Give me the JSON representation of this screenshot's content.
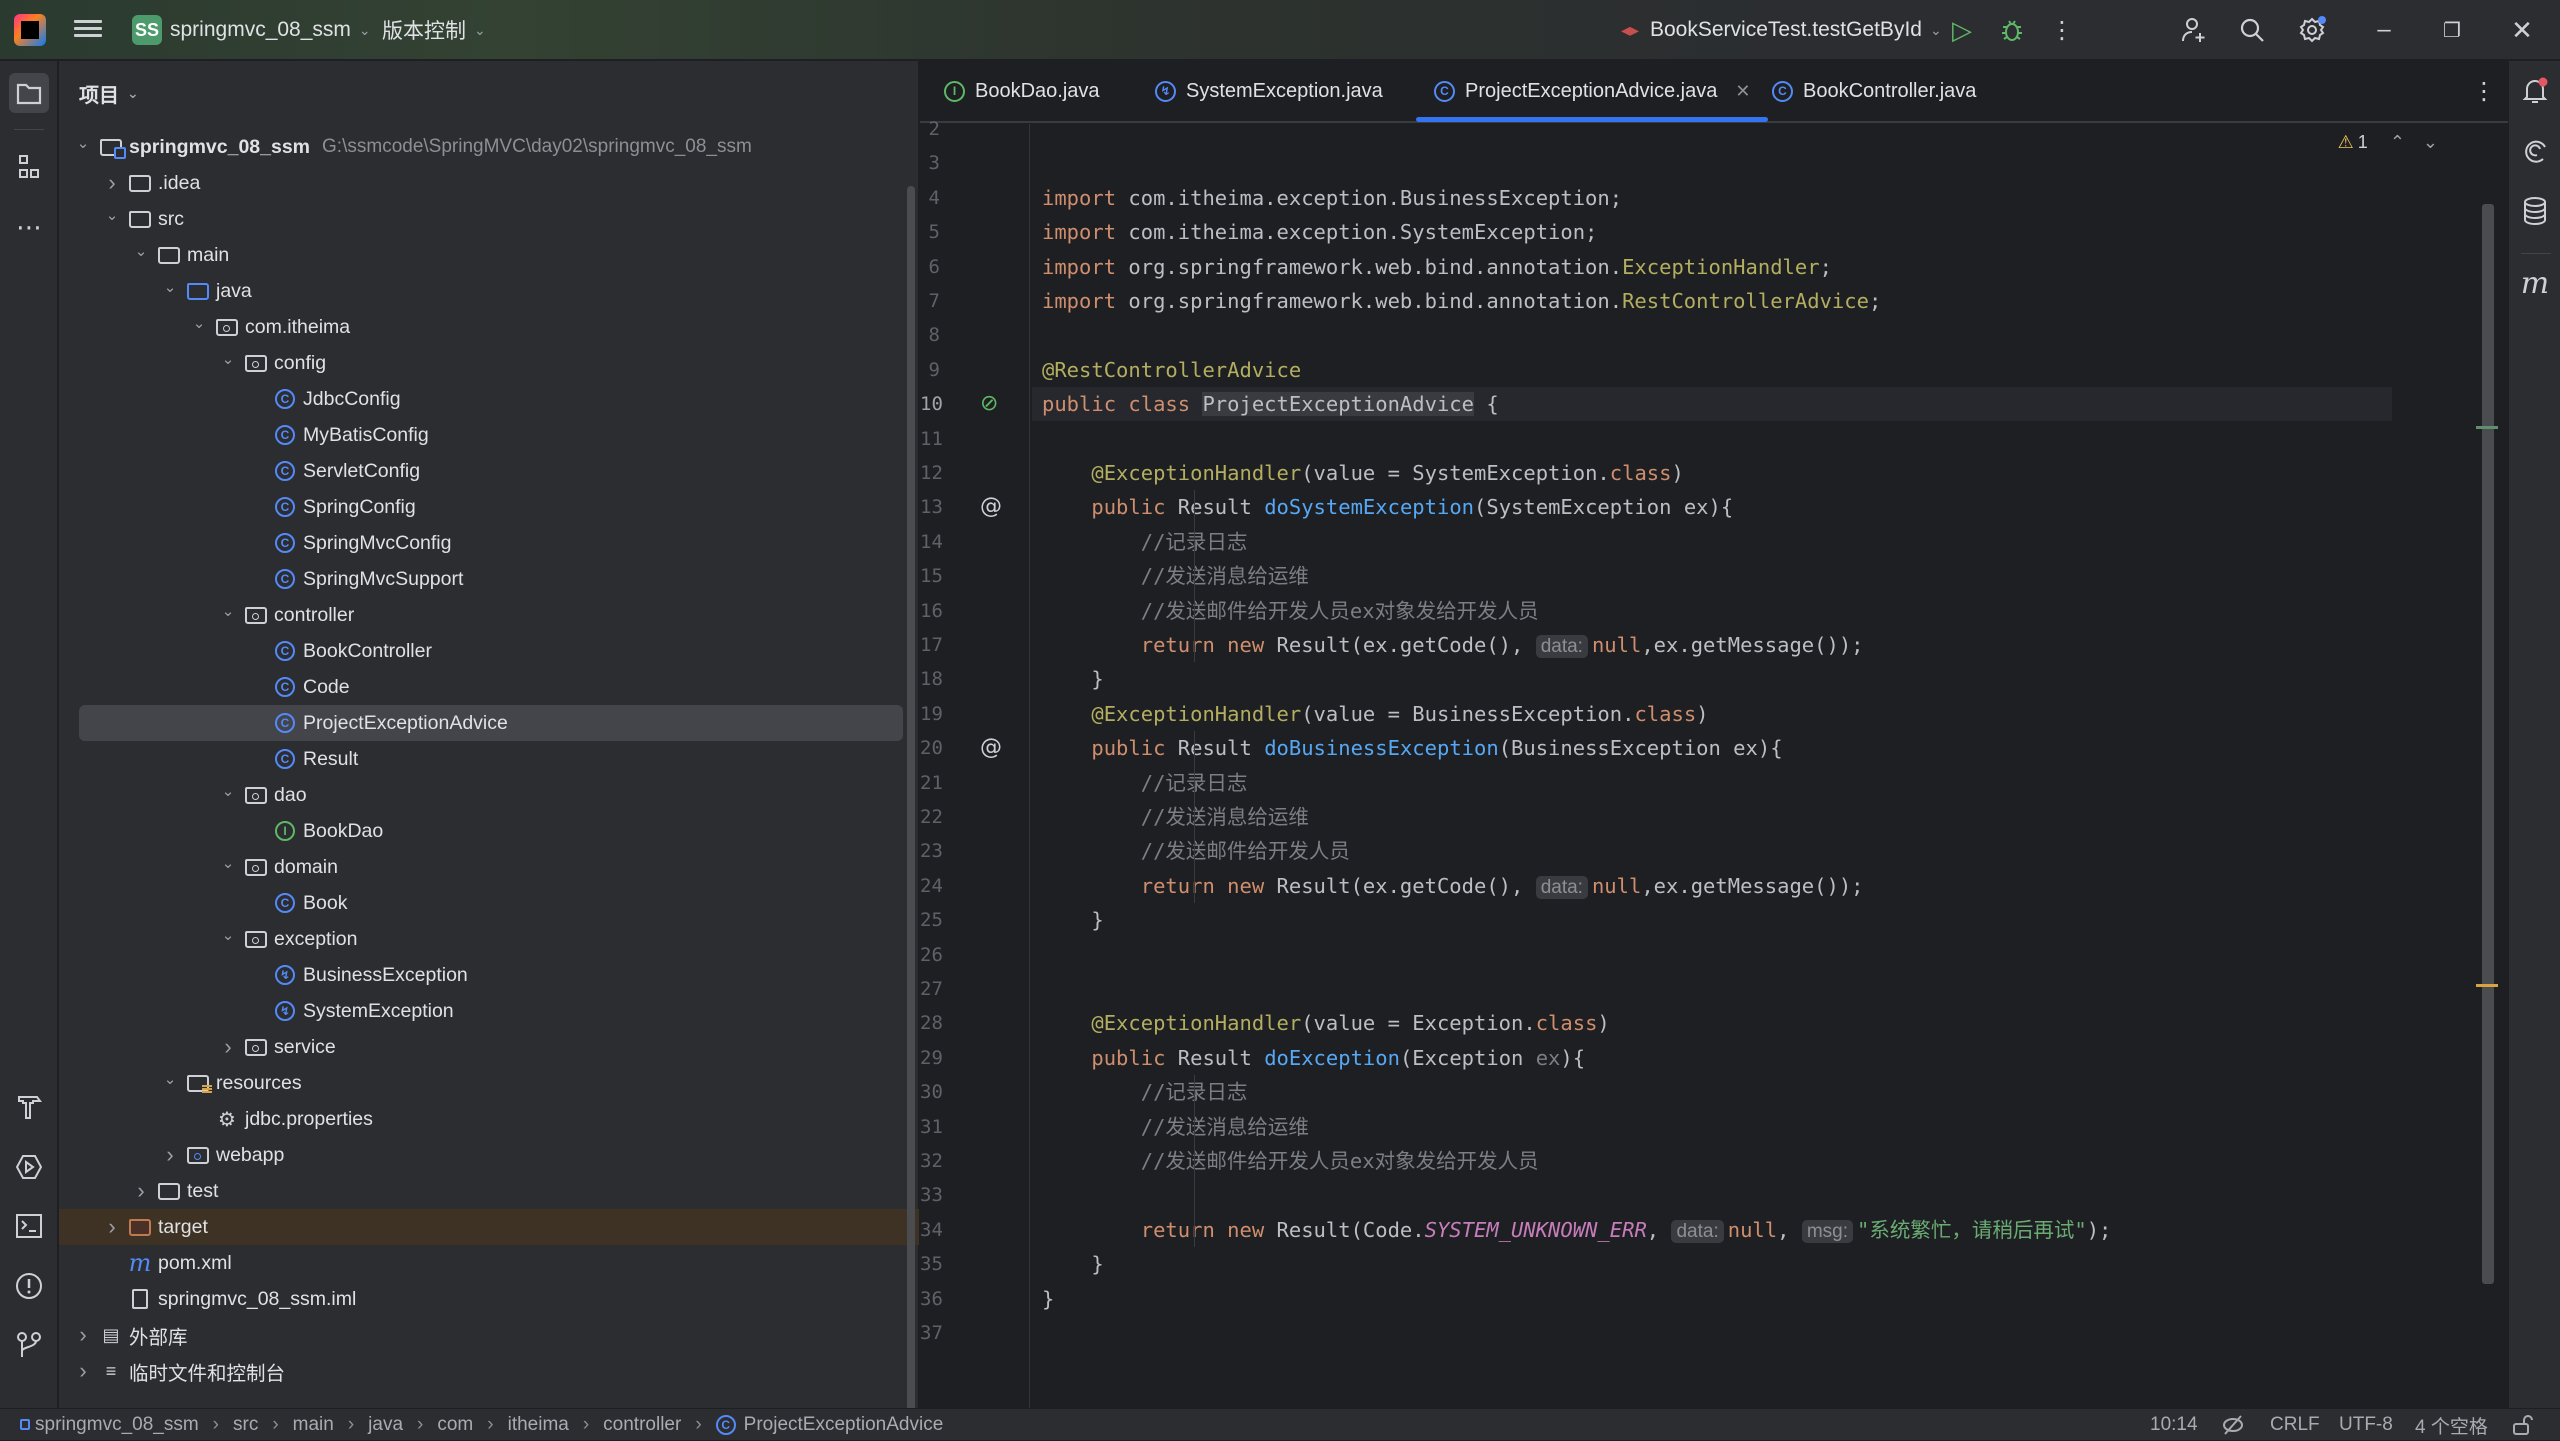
{
  "titlebar": {
    "app_icon": "intellij-idea-icon",
    "project_badge": "SS",
    "project_name": "springmvc_08_ssm",
    "vcs_label": "版本控制",
    "run_config": "BookServiceTest.testGetById",
    "icons": [
      "run-icon",
      "debug-icon",
      "more-icon",
      "add-user-icon",
      "search-icon",
      "settings-icon",
      "minimize-icon",
      "restore-icon",
      "close-icon"
    ]
  },
  "left_toolbar": [
    "project-folder-icon",
    "structure-icon",
    "more-tools-icon",
    "build-icon",
    "services-icon",
    "terminal-icon",
    "problems-icon",
    "git-icon"
  ],
  "right_toolbar": [
    "notifications-icon",
    "ai-assistant-icon",
    "database-icon",
    "maven-icon"
  ],
  "project_panel": {
    "title": "项目",
    "tree": [
      {
        "label": "springmvc_08_ssm",
        "path": "G:\\ssmcode\\SpringMVC\\day02\\springmvc_08_ssm",
        "depth": 0,
        "type": "module",
        "expanded": true
      },
      {
        "label": ".idea",
        "depth": 1,
        "type": "folder",
        "expanded": false
      },
      {
        "label": "src",
        "depth": 1,
        "type": "folder",
        "expanded": true
      },
      {
        "label": "main",
        "depth": 2,
        "type": "folder",
        "expanded": true
      },
      {
        "label": "java",
        "depth": 3,
        "type": "source-folder",
        "expanded": true
      },
      {
        "label": "com.itheima",
        "depth": 4,
        "type": "package",
        "expanded": true
      },
      {
        "label": "config",
        "depth": 5,
        "type": "package",
        "expanded": true
      },
      {
        "label": "JdbcConfig",
        "depth": 6,
        "type": "class"
      },
      {
        "label": "MyBatisConfig",
        "depth": 6,
        "type": "class"
      },
      {
        "label": "ServletConfig",
        "depth": 6,
        "type": "class"
      },
      {
        "label": "SpringConfig",
        "depth": 6,
        "type": "class"
      },
      {
        "label": "SpringMvcConfig",
        "depth": 6,
        "type": "class"
      },
      {
        "label": "SpringMvcSupport",
        "depth": 6,
        "type": "class"
      },
      {
        "label": "controller",
        "depth": 5,
        "type": "package",
        "expanded": true
      },
      {
        "label": "BookController",
        "depth": 6,
        "type": "class"
      },
      {
        "label": "Code",
        "depth": 6,
        "type": "class"
      },
      {
        "label": "ProjectExceptionAdvice",
        "depth": 6,
        "type": "class",
        "selected": true
      },
      {
        "label": "Result",
        "depth": 6,
        "type": "class"
      },
      {
        "label": "dao",
        "depth": 5,
        "type": "package",
        "expanded": true
      },
      {
        "label": "BookDao",
        "depth": 6,
        "type": "interface"
      },
      {
        "label": "domain",
        "depth": 5,
        "type": "package",
        "expanded": true
      },
      {
        "label": "Book",
        "depth": 6,
        "type": "class"
      },
      {
        "label": "exception",
        "depth": 5,
        "type": "package",
        "expanded": true
      },
      {
        "label": "BusinessException",
        "depth": 6,
        "type": "exception"
      },
      {
        "label": "SystemException",
        "depth": 6,
        "type": "exception"
      },
      {
        "label": "service",
        "depth": 5,
        "type": "package",
        "expanded": false
      },
      {
        "label": "resources",
        "depth": 3,
        "type": "resources-folder",
        "expanded": true
      },
      {
        "label": "jdbc.properties",
        "depth": 4,
        "type": "properties"
      },
      {
        "label": "webapp",
        "depth": 3,
        "type": "web-folder",
        "expanded": false
      },
      {
        "label": "test",
        "depth": 2,
        "type": "folder",
        "expanded": false
      },
      {
        "label": "target",
        "depth": 1,
        "type": "excluded-folder",
        "expanded": false
      },
      {
        "label": "pom.xml",
        "depth": 1,
        "type": "maven"
      },
      {
        "label": "springmvc_08_ssm.iml",
        "depth": 1,
        "type": "iml"
      },
      {
        "label": "外部库",
        "depth": 0,
        "type": "libraries",
        "expanded": false
      },
      {
        "label": "临时文件和控制台",
        "depth": 0,
        "type": "scratches",
        "expanded": false
      }
    ]
  },
  "tabs": [
    {
      "label": "BookDao.java",
      "icon": "interface-icon"
    },
    {
      "label": "SystemException.java",
      "icon": "exception-class-icon"
    },
    {
      "label": "ProjectExceptionAdvice.java",
      "icon": "class-icon",
      "active": true
    },
    {
      "label": "BookController.java",
      "icon": "class-icon"
    }
  ],
  "editor": {
    "warnings_count": "1",
    "first_line": 2,
    "current_line": 10,
    "lines": [
      {
        "n": "2",
        "html": ""
      },
      {
        "n": "3",
        "html": ""
      },
      {
        "n": "4",
        "html": "<span class='k'>import</span> com.itheima.exception.BusinessException;"
      },
      {
        "n": "5",
        "html": "<span class='k'>import</span> com.itheima.exception.SystemException;"
      },
      {
        "n": "6",
        "html": "<span class='k'>import</span> org.springframework.web.bind.annotation.<span class='a'>ExceptionHandler</span>;"
      },
      {
        "n": "7",
        "html": "<span class='k'>import</span> org.springframework.web.bind.annotation.<span class='a'>RestControllerAdvice</span>;"
      },
      {
        "n": "8",
        "html": ""
      },
      {
        "n": "9",
        "html": "<span class='a'>@RestControllerAdvice</span>"
      },
      {
        "n": "10",
        "html": "<span class='k'>public class</span> <span class='hl'>ProjectExceptionAdvice</span> {",
        "gutter": "implemented-icon"
      },
      {
        "n": "11",
        "html": ""
      },
      {
        "n": "12",
        "html": "    <span class='a'>@ExceptionHandler</span>(value = SystemException.<span class='k'>class</span>)"
      },
      {
        "n": "13",
        "html": "    <span class='k'>public</span> Result <span class='f'>doSystemException</span>(SystemException ex){",
        "gutter": "annotation-icon"
      },
      {
        "n": "14",
        "html": "        <span class='c'>//记录日志</span>"
      },
      {
        "n": "15",
        "html": "        <span class='c'>//发送消息给运维</span>"
      },
      {
        "n": "16",
        "html": "        <span class='c'>//发送邮件给开发人员ex对象发给开发人员</span>"
      },
      {
        "n": "17",
        "html": "        <span class='k'>return new</span> Result(ex.getCode(), <span class='hint'>data:</span><span class='k'>null</span>,ex.getMessage());"
      },
      {
        "n": "18",
        "html": "    }"
      },
      {
        "n": "19",
        "html": "    <span class='a'>@ExceptionHandler</span>(value = BusinessException.<span class='k'>class</span>)"
      },
      {
        "n": "20",
        "html": "    <span class='k'>public</span> Result <span class='f'>doBusinessException</span>(BusinessException ex){",
        "gutter": "annotation-icon"
      },
      {
        "n": "21",
        "html": "        <span class='c'>//记录日志</span>"
      },
      {
        "n": "22",
        "html": "        <span class='c'>//发送消息给运维</span>"
      },
      {
        "n": "23",
        "html": "        <span class='c'>//发送邮件给开发人员</span>"
      },
      {
        "n": "24",
        "html": "        <span class='k'>return new</span> Result(ex.getCode(), <span class='hint'>data:</span><span class='k'>null</span>,ex.getMessage());"
      },
      {
        "n": "25",
        "html": "    }"
      },
      {
        "n": "26",
        "html": ""
      },
      {
        "n": "27",
        "html": ""
      },
      {
        "n": "28",
        "html": "    <span class='a'>@ExceptionHandler</span>(value = Exception.<span class='k'>class</span>)"
      },
      {
        "n": "29",
        "html": "    <span class='k'>public</span> Result <span class='f'>doException</span>(Exception <span class='p'>ex</span>){"
      },
      {
        "n": "30",
        "html": "        <span class='c'>//记录日志</span>"
      },
      {
        "n": "31",
        "html": "        <span class='c'>//发送消息给运维</span>"
      },
      {
        "n": "32",
        "html": "        <span class='c'>//发送邮件给开发人员ex对象发给开发人员</span>"
      },
      {
        "n": "33",
        "html": ""
      },
      {
        "n": "34",
        "html": "        <span class='k'>return new</span> Result(Code.<span class='cn'>SYSTEM_UNKNOWN_ERR</span>, <span class='hint'>data:</span><span class='k'>null</span>, <span class='hint'>msg:</span><span class='s'>\"系统繁忙，请稍后再试\"</span>);"
      },
      {
        "n": "35",
        "html": "    }"
      },
      {
        "n": "36",
        "html": "}"
      },
      {
        "n": "37",
        "html": ""
      }
    ]
  },
  "statusbar": {
    "breadcrumbs": [
      "springmvc_08_ssm",
      "src",
      "main",
      "java",
      "com",
      "itheima",
      "controller",
      "ProjectExceptionAdvice"
    ],
    "cursor_position": "10:14",
    "line_separator": "CRLF",
    "encoding": "UTF-8",
    "indent": "4 个空格"
  },
  "colors": {
    "accent": "#3574f0",
    "keyword": "#cf8e6d",
    "annotation": "#b3ae60",
    "method": "#56a8f5",
    "comment": "#7a7e85",
    "string": "#6aab73",
    "constant": "#c77dbb"
  }
}
